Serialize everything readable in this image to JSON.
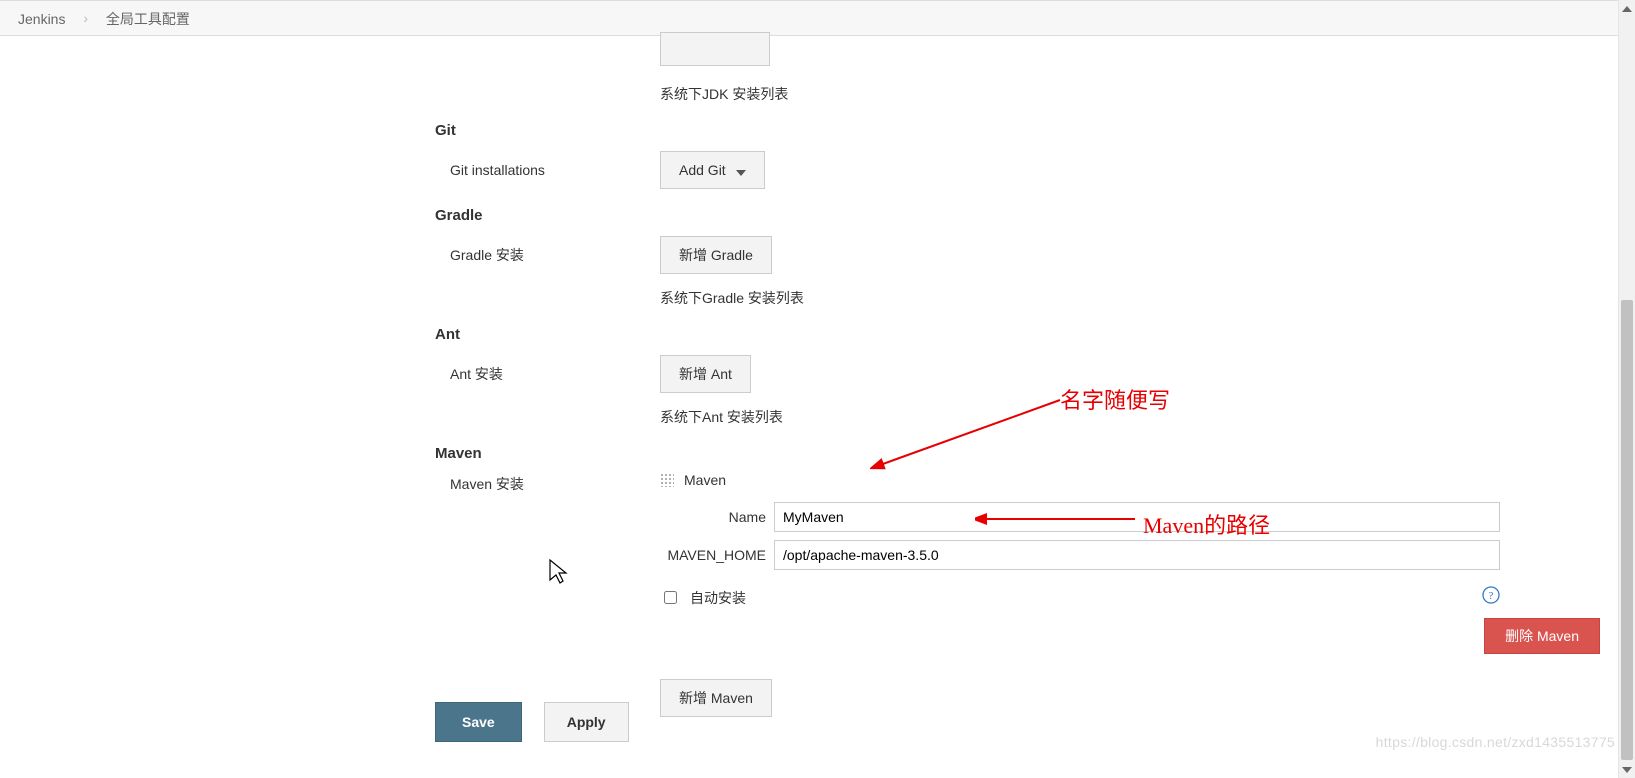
{
  "breadcrumb": {
    "root": "Jenkins",
    "current": "全局工具配置"
  },
  "jdk": {
    "list_hint": "系统下JDK 安装列表"
  },
  "git": {
    "heading": "Git",
    "installations_label": "Git installations",
    "add_button": "Add Git"
  },
  "gradle": {
    "heading": "Gradle",
    "install_label": "Gradle 安装",
    "add_button": "新增 Gradle",
    "list_hint": "系统下Gradle 安装列表"
  },
  "ant": {
    "heading": "Ant",
    "install_label": "Ant 安装",
    "add_button": "新增 Ant",
    "list_hint": "系统下Ant 安装列表"
  },
  "maven": {
    "heading": "Maven",
    "install_label": "Maven 安装",
    "item_title": "Maven",
    "name_label": "Name",
    "name_value": "MyMaven",
    "home_label": "MAVEN_HOME",
    "home_value": "/opt/apache-maven-3.5.0",
    "auto_install_label": "自动安装",
    "delete_button": "删除 Maven",
    "add_button": "新增 Maven"
  },
  "footer": {
    "save": "Save",
    "apply": "Apply"
  },
  "annotations": {
    "name_hint": "名字随便写",
    "path_hint": "Maven的路径"
  },
  "watermark": "https://blog.csdn.net/zxd1435513775"
}
